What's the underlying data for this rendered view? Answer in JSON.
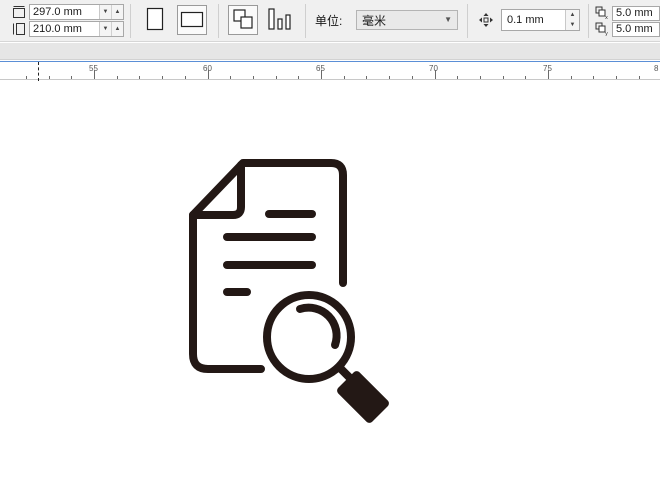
{
  "page_size": {
    "width_value": "297.0 mm",
    "height_value": "210.0 mm"
  },
  "units": {
    "label": "单位:",
    "selected": "毫米"
  },
  "nudge": {
    "value": "0.1 mm"
  },
  "duplicate_distance": {
    "x_value": "5.0 mm",
    "y_value": "5.0 mm"
  },
  "ruler": {
    "labels": [
      "55",
      "60",
      "65",
      "70",
      "75",
      "8"
    ]
  },
  "icons": {
    "page_width": "page-width-icon",
    "page_height": "page-height-icon",
    "portrait": "portrait-page-icon",
    "landscape": "landscape-page-icon",
    "all_pages": "all-pages-icon",
    "current_page": "current-page-icon",
    "nudge": "nudge-icon",
    "dup_x": "duplicate-x-icon",
    "dup_y": "duplicate-y-icon",
    "canvas_artwork": "document-search-icon"
  },
  "colors": {
    "artwork": "#231815",
    "toolbar_bg": "#f0f0f0",
    "ruler_accent": "#5b8fd6"
  }
}
